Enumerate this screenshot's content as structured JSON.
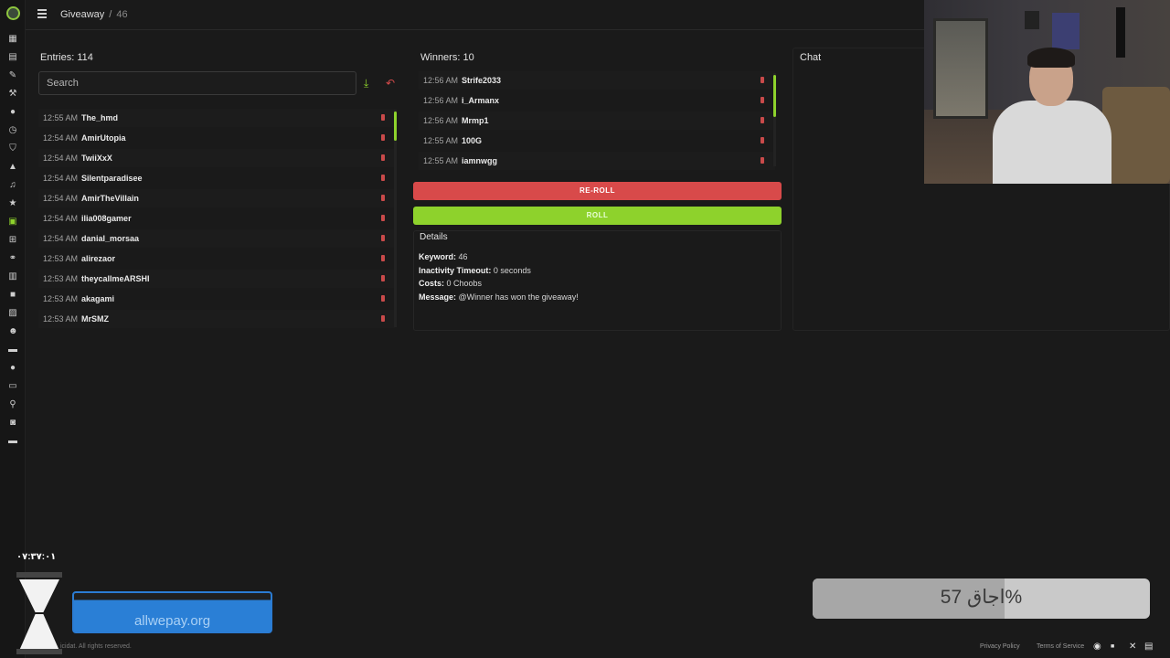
{
  "breadcrumb": {
    "section": "Giveaway",
    "separator": "/",
    "current": "46"
  },
  "entries": {
    "title": "Entries: 114",
    "search_placeholder": "Search",
    "rows": [
      {
        "time": "12:55 AM",
        "user": "The_hmd"
      },
      {
        "time": "12:54 AM",
        "user": "AmirUtopia"
      },
      {
        "time": "12:54 AM",
        "user": "TwiiXxX"
      },
      {
        "time": "12:54 AM",
        "user": "Silentparadisee"
      },
      {
        "time": "12:54 AM",
        "user": "AmirTheVillain"
      },
      {
        "time": "12:54 AM",
        "user": "ilia008gamer"
      },
      {
        "time": "12:54 AM",
        "user": "danial_morsaa"
      },
      {
        "time": "12:53 AM",
        "user": "alirezaor"
      },
      {
        "time": "12:53 AM",
        "user": "theycallmeARSHI"
      },
      {
        "time": "12:53 AM",
        "user": "akagami"
      },
      {
        "time": "12:53 AM",
        "user": "MrSMZ"
      }
    ]
  },
  "winners": {
    "title": "Winners: 10",
    "rows": [
      {
        "time": "12:56 AM",
        "user": "Strife2033"
      },
      {
        "time": "12:56 AM",
        "user": "i_Armanx"
      },
      {
        "time": "12:56 AM",
        "user": "Mrmp1"
      },
      {
        "time": "12:55 AM",
        "user": "100G"
      },
      {
        "time": "12:55 AM",
        "user": "iamnwgg"
      }
    ],
    "reroll_label": "RE-ROLL",
    "roll_label": "ROLL"
  },
  "details": {
    "title": "Details",
    "keyword_label": "Keyword:",
    "keyword_value": "46",
    "inactivity_label": "Inactivity Timeout:",
    "inactivity_value": "0 seconds",
    "costs_label": "Costs:",
    "costs_value": "0 Choobs",
    "message_label": "Message:",
    "message_value": "@Winner has won the giveaway!"
  },
  "chat": {
    "title": "Chat"
  },
  "overlay": {
    "timer": "۰۷:۳۷:۰۱",
    "watermark": "allwepay.org",
    "progress_text": "اجاق 57%",
    "progress_value": 0.57
  },
  "footer": {
    "copyright": "icidat. All rights reserved.",
    "privacy": "Privacy Policy",
    "terms": "Terms of Service"
  },
  "colors": {
    "accent_green": "#8ed22c",
    "danger_red": "#d84a4a"
  },
  "icons": {
    "rail": [
      "dashboard-icon",
      "document-icon",
      "pen-icon",
      "wand-icon",
      "chat-icon",
      "clock-icon",
      "shield-icon",
      "alert-icon",
      "music-icon",
      "star-icon",
      "gift-icon",
      "cart-icon",
      "link-icon",
      "chart-icon",
      "video-icon",
      "box-icon",
      "emoji-icon",
      "film-icon",
      "message-icon",
      "monitor-icon",
      "search-icon",
      "gamepad-icon",
      "wallet-icon"
    ]
  }
}
